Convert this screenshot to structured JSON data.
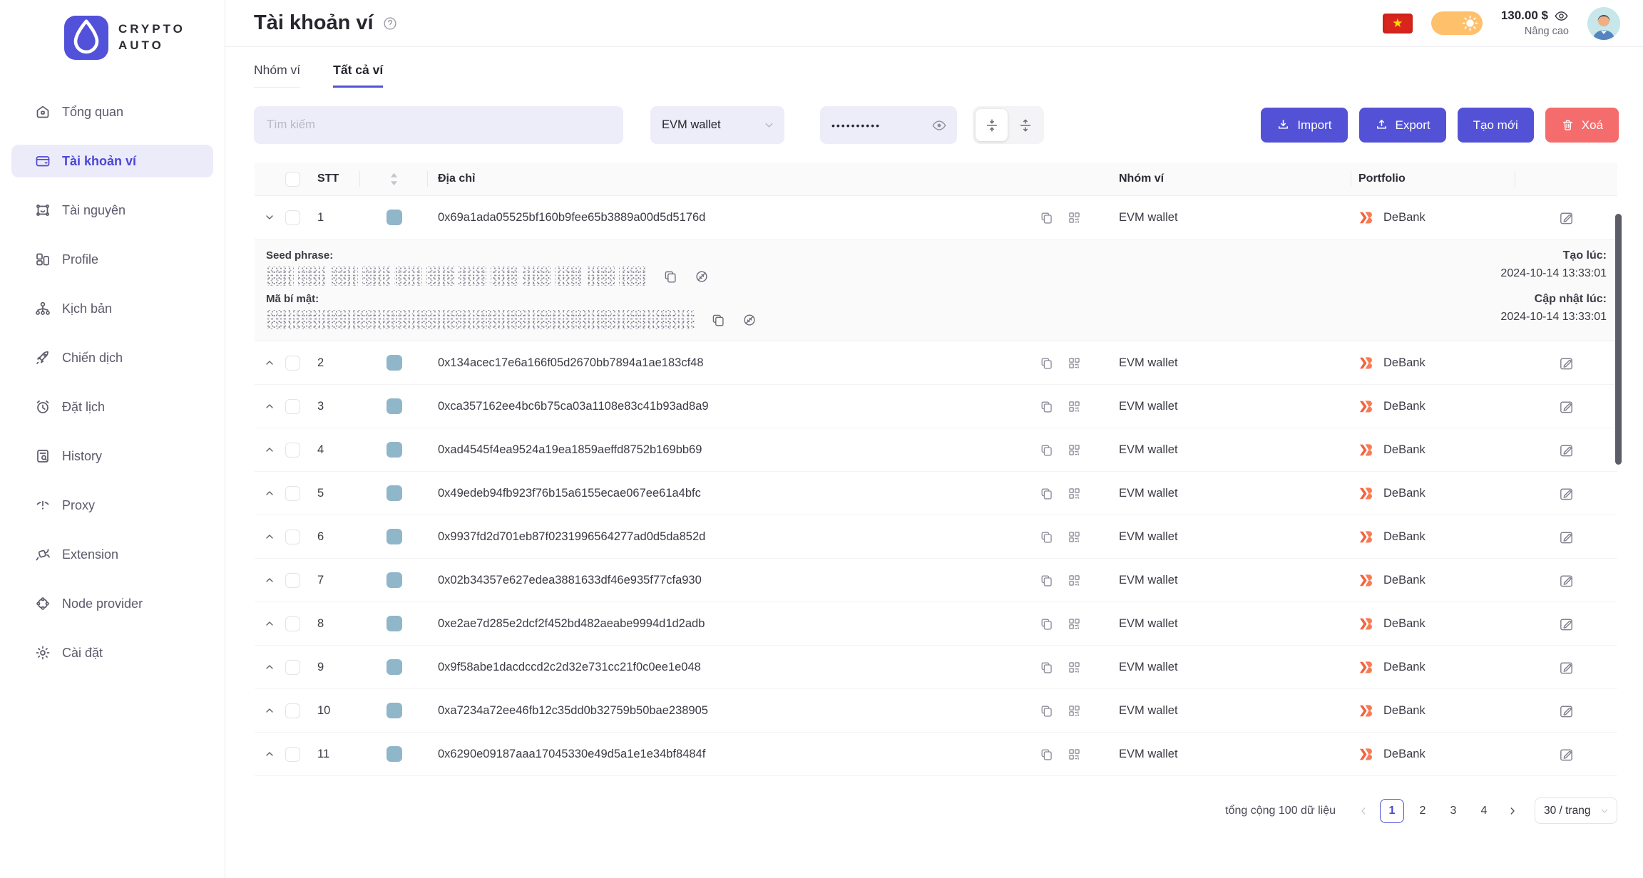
{
  "brand": {
    "line1": "CRYPTO",
    "line2": "AUTO"
  },
  "sidebar": {
    "items": [
      {
        "label": "Tổng quan",
        "icon": "home-icon",
        "active": false
      },
      {
        "label": "Tài khoản ví",
        "icon": "wallet-icon",
        "active": true
      },
      {
        "label": "Tài nguyên",
        "icon": "resource-icon",
        "active": false
      },
      {
        "label": "Profile",
        "icon": "profile-icon",
        "active": false
      },
      {
        "label": "Kịch bản",
        "icon": "scenario-icon",
        "active": false
      },
      {
        "label": "Chiến dịch",
        "icon": "rocket-icon",
        "active": false
      },
      {
        "label": "Đặt lịch",
        "icon": "alarm-icon",
        "active": false
      },
      {
        "label": "History",
        "icon": "history-icon",
        "active": false
      },
      {
        "label": "Proxy",
        "icon": "proxy-icon",
        "active": false
      },
      {
        "label": "Extension",
        "icon": "extension-icon",
        "active": false
      },
      {
        "label": "Node provider",
        "icon": "node-icon",
        "active": false
      },
      {
        "label": "Cài đặt",
        "icon": "gear-icon",
        "active": false
      }
    ]
  },
  "header": {
    "title": "Tài khoản ví",
    "balance": "130.00 $",
    "mode": "Nâng cao"
  },
  "tabs": {
    "items": [
      {
        "label": "Nhóm ví"
      },
      {
        "label": "Tất cả ví"
      }
    ],
    "active_index": 1
  },
  "toolbar": {
    "search_placeholder": "Tìm kiếm",
    "wallet_type": "EVM wallet",
    "password_mask": "••••••••••",
    "import_label": "Import",
    "export_label": "Export",
    "create_label": "Tạo mới",
    "delete_label": "Xoá"
  },
  "table": {
    "headers": {
      "stt": "STT",
      "address": "Địa chỉ",
      "group": "Nhóm ví",
      "portfolio": "Portfolio"
    },
    "expanded": {
      "seed_label": "Seed phrase:",
      "secret_label": "Mã bí mật:",
      "created_label": "Tạo lúc:",
      "created_value": "2024-10-14 13:33:01",
      "updated_label": "Cập nhật lúc:",
      "updated_value": "2024-10-14 13:33:01"
    },
    "rows": [
      {
        "stt": "1",
        "address": "0x69a1ada05525bf160b9fee65b3889a00d5d5176d",
        "group": "EVM wallet",
        "portfolio": "DeBank",
        "expanded": true
      },
      {
        "stt": "2",
        "address": "0x134acec17e6a166f05d2670bb7894a1ae183cf48",
        "group": "EVM wallet",
        "portfolio": "DeBank",
        "expanded": false
      },
      {
        "stt": "3",
        "address": "0xca357162ee4bc6b75ca03a1108e83c41b93ad8a9",
        "group": "EVM wallet",
        "portfolio": "DeBank",
        "expanded": false
      },
      {
        "stt": "4",
        "address": "0xad4545f4ea9524a19ea1859aeffd8752b169bb69",
        "group": "EVM wallet",
        "portfolio": "DeBank",
        "expanded": false
      },
      {
        "stt": "5",
        "address": "0x49edeb94fb923f76b15a6155ecae067ee61a4bfc",
        "group": "EVM wallet",
        "portfolio": "DeBank",
        "expanded": false
      },
      {
        "stt": "6",
        "address": "0x9937fd2d701eb87f0231996564277ad0d5da852d",
        "group": "EVM wallet",
        "portfolio": "DeBank",
        "expanded": false
      },
      {
        "stt": "7",
        "address": "0x02b34357e627edea3881633df46e935f77cfa930",
        "group": "EVM wallet",
        "portfolio": "DeBank",
        "expanded": false
      },
      {
        "stt": "8",
        "address": "0xe2ae7d285e2dcf2f452bd482aeabe9994d1d2adb",
        "group": "EVM wallet",
        "portfolio": "DeBank",
        "expanded": false
      },
      {
        "stt": "9",
        "address": "0x9f58abe1dacdccd2c2d32e731cc21f0c0ee1e048",
        "group": "EVM wallet",
        "portfolio": "DeBank",
        "expanded": false
      },
      {
        "stt": "10",
        "address": "0xa7234a72ee46fb12c35dd0b32759b50bae238905",
        "group": "EVM wallet",
        "portfolio": "DeBank",
        "expanded": false
      },
      {
        "stt": "11",
        "address": "0x6290e09187aaa17045330e49d5a1e1e34bf8484f",
        "group": "EVM wallet",
        "portfolio": "DeBank",
        "expanded": false
      }
    ]
  },
  "pagination": {
    "total": "tổng cộng 100 dữ liệu",
    "pages": [
      "1",
      "2",
      "3",
      "4"
    ],
    "current": "1",
    "size": "30 / trang"
  },
  "colors": {
    "primary": "#5352D6",
    "danger": "#F56C6C",
    "debank": "#F4623F",
    "address_square": "#8FB6C9",
    "active_item_bg": "#ECEBFA",
    "toggle": "#FFC06C",
    "flag": "#DA251D",
    "flag_star": "#FFDE00",
    "input_bg": "#EDECF9"
  }
}
